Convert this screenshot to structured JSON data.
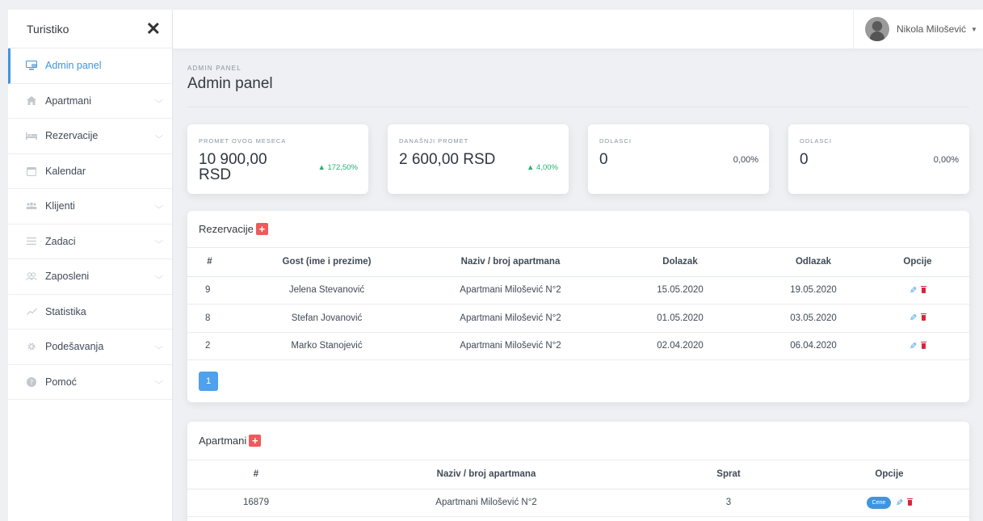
{
  "sidebar": {
    "brand": "Turistiko",
    "close_icon": "✕",
    "items": [
      {
        "label": "Admin panel",
        "icon": "monitor-icon",
        "active": true,
        "has_children": false
      },
      {
        "label": "Apartmani",
        "icon": "home-icon",
        "active": false,
        "has_children": true
      },
      {
        "label": "Rezervacije",
        "icon": "bed-icon",
        "active": false,
        "has_children": true
      },
      {
        "label": "Kalendar",
        "icon": "calendar-icon",
        "active": false,
        "has_children": false
      },
      {
        "label": "Klijenti",
        "icon": "users-icon",
        "active": false,
        "has_children": true
      },
      {
        "label": "Zadaci",
        "icon": "list-icon",
        "active": false,
        "has_children": true
      },
      {
        "label": "Zaposleni",
        "icon": "people-icon",
        "active": false,
        "has_children": true
      },
      {
        "label": "Statistika",
        "icon": "chart-line-icon",
        "active": false,
        "has_children": false
      },
      {
        "label": "Podešavanja",
        "icon": "gear-icon",
        "active": false,
        "has_children": true
      },
      {
        "label": "Pomoć",
        "icon": "help-icon",
        "active": false,
        "has_children": true
      }
    ]
  },
  "topbar": {
    "user_name": "Nikola Milošević"
  },
  "header": {
    "breadcrumb": "ADMIN PANEL",
    "title": "Admin panel"
  },
  "stats": [
    {
      "label": "PROMET OVOG MESECA",
      "value": "10 900,00 RSD",
      "change": "▲ 172,50%"
    },
    {
      "label": "DANAŠNJI PROMET",
      "value": "2 600,00 RSD",
      "change": "▲ 4,00%"
    },
    {
      "label": "DOLASCI",
      "value": "0",
      "percent": "0,00%"
    },
    {
      "label": "ODLASCI",
      "value": "0",
      "percent": "0,00%"
    }
  ],
  "reservations": {
    "title": "Rezervacije",
    "columns": [
      "#",
      "Gost (ime i prezime)",
      "Naziv / broj apartmana",
      "Dolazak",
      "Odlazak",
      "Opcije"
    ],
    "rows": [
      {
        "id": "9",
        "guest": "Jelena Stevanović",
        "apartment": "Apartmani Milošević N°2",
        "arrival": "15.05.2020",
        "departure": "19.05.2020"
      },
      {
        "id": "8",
        "guest": "Stefan Jovanović",
        "apartment": "Apartmani Milošević N°2",
        "arrival": "01.05.2020",
        "departure": "03.05.2020"
      },
      {
        "id": "2",
        "guest": "Marko Stanojević",
        "apartment": "Apartmani Milošević N°2",
        "arrival": "02.04.2020",
        "departure": "06.04.2020"
      }
    ],
    "page": "1"
  },
  "apartments": {
    "title": "Apartmani",
    "columns": [
      "#",
      "Naziv / broj apartmana",
      "Sprat",
      "Opcije"
    ],
    "rows": [
      {
        "id": "16879",
        "name": "Apartmani Milošević N°2",
        "floor": "3",
        "prices_label": "Cene"
      }
    ]
  },
  "colors": {
    "accent": "#3f95e0",
    "positive": "#26b36e",
    "danger": "#d9243a",
    "add": "#ef5a5a"
  }
}
